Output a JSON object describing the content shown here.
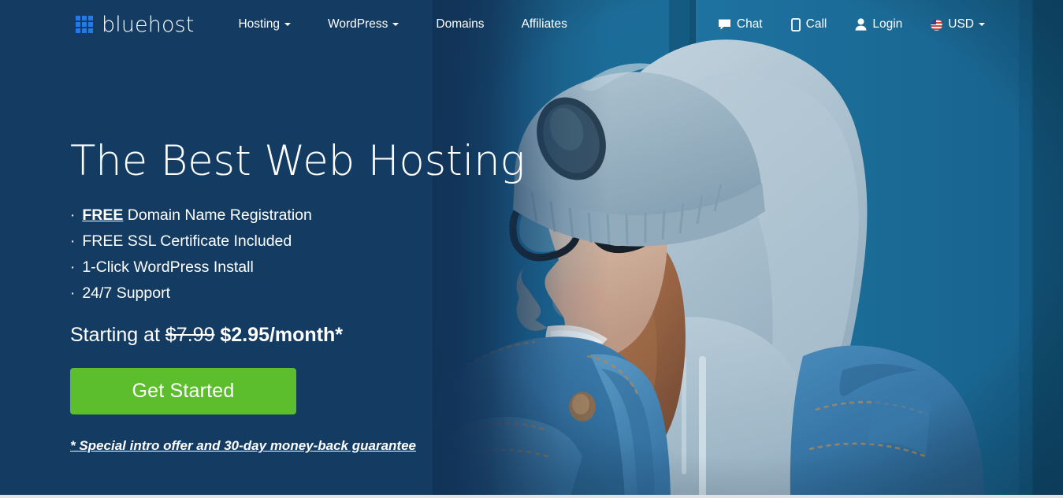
{
  "brand": {
    "name": "bluehost",
    "logo_icon": "grid-squares-icon",
    "logo_color": "#1f7ce8"
  },
  "nav": {
    "main_items": [
      {
        "label": "Hosting",
        "has_dropdown": true
      },
      {
        "label": "WordPress",
        "has_dropdown": true
      },
      {
        "label": "Domains",
        "has_dropdown": false
      },
      {
        "label": "Affiliates",
        "has_dropdown": false
      }
    ],
    "right_items": [
      {
        "label": "Chat",
        "icon": "chat-bubble-icon",
        "has_dropdown": false
      },
      {
        "label": "Call",
        "icon": "mobile-phone-icon",
        "has_dropdown": false
      },
      {
        "label": "Login",
        "icon": "user-person-icon",
        "has_dropdown": false
      },
      {
        "label": "USD",
        "icon": "us-flag-icon",
        "has_dropdown": true
      }
    ]
  },
  "hero": {
    "headline": "The Best Web Hosting",
    "bullets": [
      {
        "bullet": "·",
        "emphasis": "FREE",
        "rest": " Domain Name Registration"
      },
      {
        "bullet": "·",
        "emphasis": "",
        "rest": "FREE SSL Certificate Included"
      },
      {
        "bullet": "·",
        "emphasis": "",
        "rest": "1-Click WordPress Install"
      },
      {
        "bullet": "·",
        "emphasis": "",
        "rest": "24/7 Support"
      }
    ],
    "price_prefix": "Starting at ",
    "price_old": "$7.99",
    "price_new": " $2.95/month*",
    "cta_label": "Get Started",
    "disclaimer": "* Special intro offer and 30-day money-back guarantee",
    "cta_color": "#5cbe2c",
    "background_color": "#143c63",
    "photo_alt": "smiling-woman-beanie-glasses-denim-jacket"
  }
}
